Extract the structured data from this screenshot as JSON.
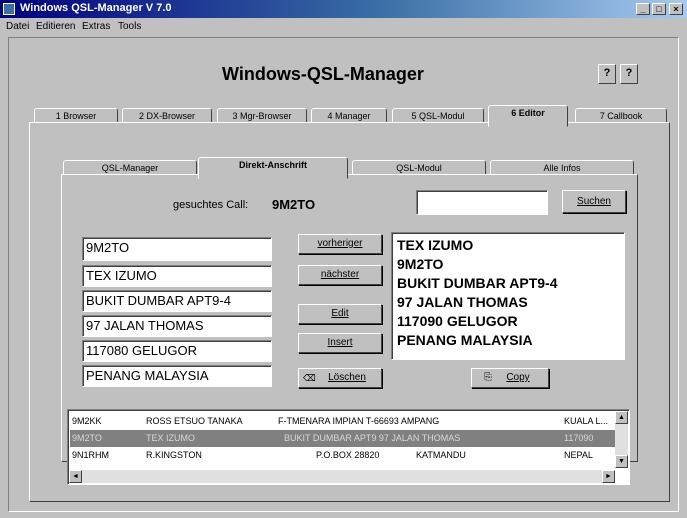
{
  "window": {
    "title": "Windows QSL-Manager V 7.0"
  },
  "menu": [
    "Datei",
    "Editieren",
    "Extras",
    "Tools"
  ],
  "header": {
    "title": "Windows-QSL-Manager"
  },
  "top_tabs": [
    "1 Browser",
    "2 DX-Browser",
    "3 Mgr-Browser",
    "4 Manager",
    "5 QSL-Modul",
    "6 Editor",
    "7 Callbook"
  ],
  "sub_tabs": [
    "QSL-Manager",
    "Direkt-Anschrift",
    "QSL-Modul",
    "Alle Infos"
  ],
  "search": {
    "label": "gesuchtes Call:",
    "call": "9M2TO",
    "value": "",
    "button": "Suchen"
  },
  "fields": [
    "9M2TO",
    "TEX IZUMO",
    "BUKIT DUMBAR APT9-4",
    "97 JALAN THOMAS",
    "117080 GELUGOR",
    "PENANG MALAYSIA"
  ],
  "buttons": {
    "prev": "vorheriger",
    "next": "nächster",
    "edit": "Edit",
    "insert": "Insert",
    "delete": "Löschen",
    "copy": "Copy"
  },
  "address": [
    "TEX IZUMO",
    "9M2TO",
    "BUKIT DUMBAR APT9-4",
    "97 JALAN THOMAS",
    "117090 GELUGOR",
    "PENANG MALAYSIA"
  ],
  "list": [
    {
      "call": "9M2KK",
      "name": "ROSS ETSUO TANAKA",
      "addr": "F-TMENARA IMPIAN T-66693 AMPANG",
      "city": "KUALA L...",
      "selected": false
    },
    {
      "call": "9M2TO",
      "name": "TEX IZUMO",
      "addr": "BUKIT DUMBAR APT9 97 JALAN THOMAS",
      "city": "117090",
      "selected": true
    },
    {
      "call": "9N1RHM",
      "name": "R.KINGSTON",
      "addr": "P.O.BOX 28820",
      "city2": "KATMANDU",
      "city": "NEPAL",
      "selected": false
    }
  ]
}
